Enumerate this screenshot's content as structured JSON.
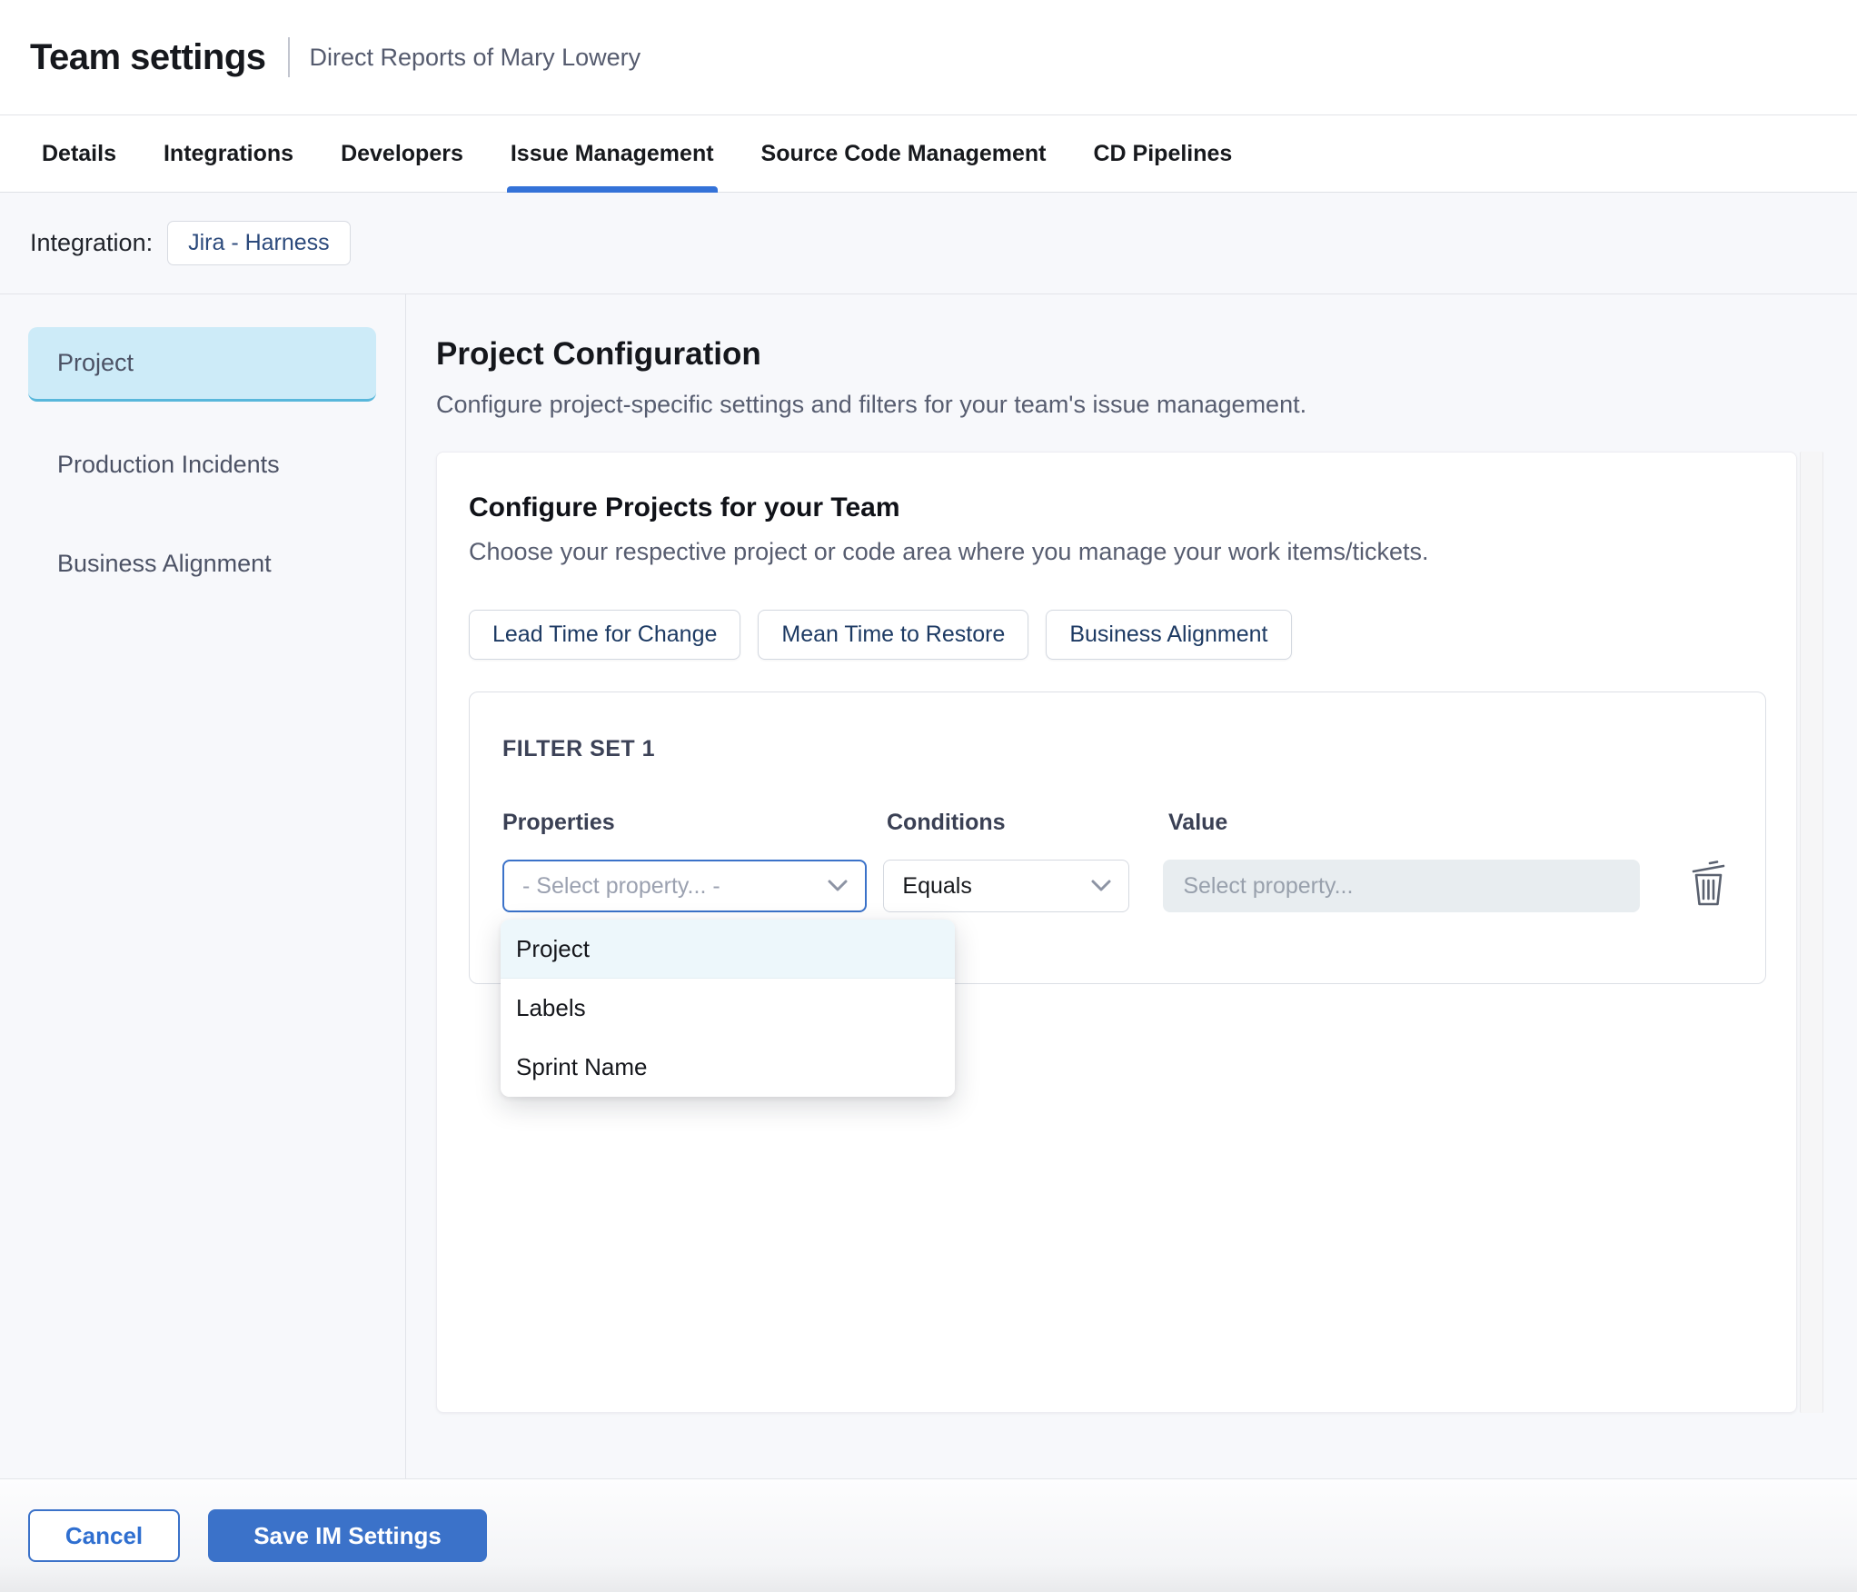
{
  "header": {
    "title": "Team settings",
    "subtitle": "Direct Reports of Mary Lowery"
  },
  "tabs": {
    "items": [
      {
        "label": "Details",
        "active": false
      },
      {
        "label": "Integrations",
        "active": false
      },
      {
        "label": "Developers",
        "active": false
      },
      {
        "label": "Issue Management",
        "active": true
      },
      {
        "label": "Source Code Management",
        "active": false
      },
      {
        "label": "CD Pipelines",
        "active": false
      }
    ]
  },
  "integration": {
    "label": "Integration:",
    "chip": "Jira - Harness"
  },
  "sidebar": {
    "items": [
      {
        "label": "Project",
        "selected": true
      },
      {
        "label": "Production Incidents",
        "selected": false
      },
      {
        "label": "Business Alignment",
        "selected": false
      }
    ]
  },
  "main": {
    "title": "Project Configuration",
    "description": "Configure project-specific settings and filters for your team's issue management.",
    "card": {
      "title": "Configure Projects for your Team",
      "subtitle": "Choose your respective project or code area where you manage your work items/tickets.",
      "chips": [
        {
          "label": "Lead Time for Change"
        },
        {
          "label": "Mean Time to Restore"
        },
        {
          "label": "Business Alignment"
        }
      ],
      "filter_set": {
        "title": "FILTER SET 1",
        "columns": {
          "properties": "Properties",
          "conditions": "Conditions",
          "value": "Value"
        },
        "properties_select": {
          "value": "- Select property... -"
        },
        "conditions_select": {
          "value": "Equals"
        },
        "value_input": {
          "placeholder": "Select property..."
        },
        "dropdown": {
          "options": [
            {
              "label": "Project",
              "highlighted": true
            },
            {
              "label": "Labels",
              "highlighted": false
            },
            {
              "label": "Sprint Name",
              "highlighted": false
            }
          ]
        }
      }
    }
  },
  "footer": {
    "cancel_label": "Cancel",
    "save_label": "Save IM Settings"
  },
  "icons": {
    "chevron_down": "chevron-down-icon",
    "trash": "trash-icon"
  },
  "colors": {
    "accent_blue": "#3b72c9",
    "tab_underline": "#3472d8",
    "selected_item_bg": "#cdebf8",
    "selected_item_border": "#58b7db",
    "dropdown_highlight": "#edf7fb",
    "chip_text": "#1d3a63",
    "value_input_bg": "#e8edf0",
    "content_bg": "#f7f8fb"
  }
}
